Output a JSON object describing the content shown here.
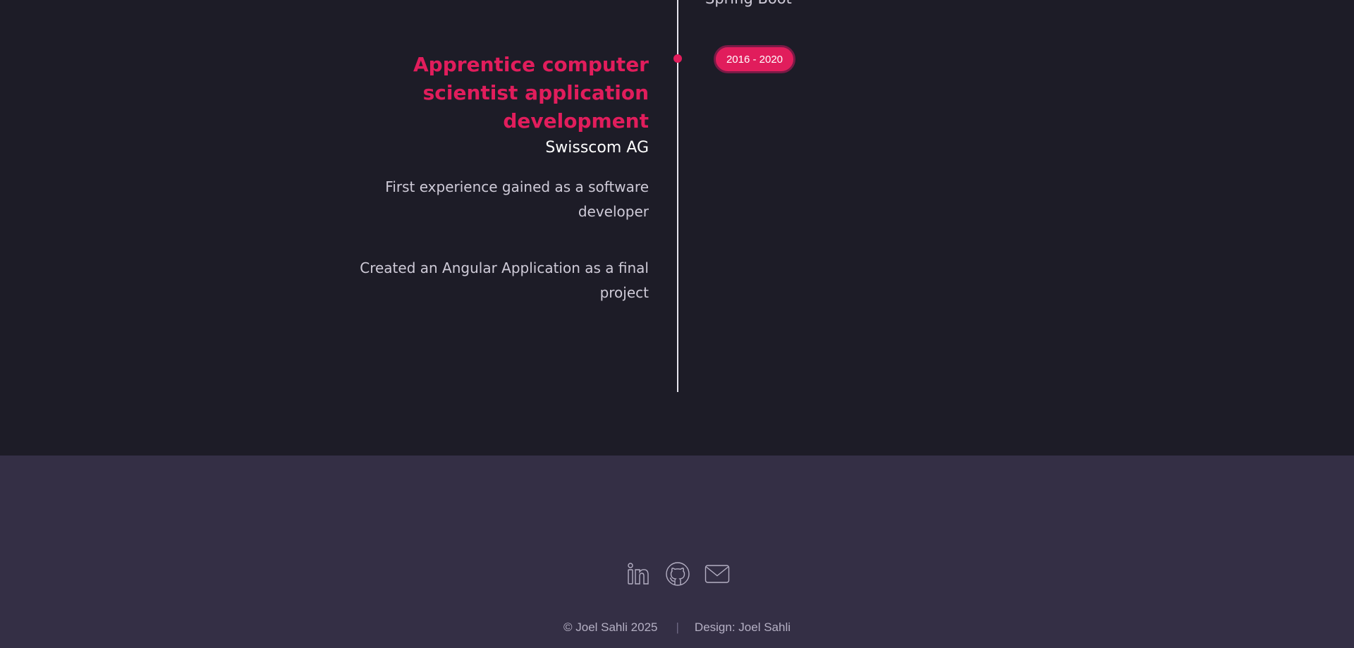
{
  "timeline": {
    "previous_item_fragment": "Spring Boot",
    "entry": {
      "title": "Apprentice computer scientist application development",
      "company": "Swisscom AG",
      "date": "2016 - 2020",
      "descriptions": [
        "First experience gained as a software developer",
        "Created an Angular Application as a final project"
      ]
    }
  },
  "footer": {
    "social": [
      {
        "icon": "linkedin-icon",
        "label": "LinkedIn"
      },
      {
        "icon": "github-icon",
        "label": "GitHub"
      },
      {
        "icon": "mail-icon",
        "label": "Email"
      }
    ],
    "copyright": "© Joel Sahli 2025",
    "separator": "|",
    "design_credit": "Design: Joel Sahli"
  },
  "colors": {
    "background": "#1d1c27",
    "footer_background": "#342f45",
    "accent": "#e11d5c",
    "text_primary": "#ffffff",
    "text_secondary": "#cfcbd8"
  }
}
